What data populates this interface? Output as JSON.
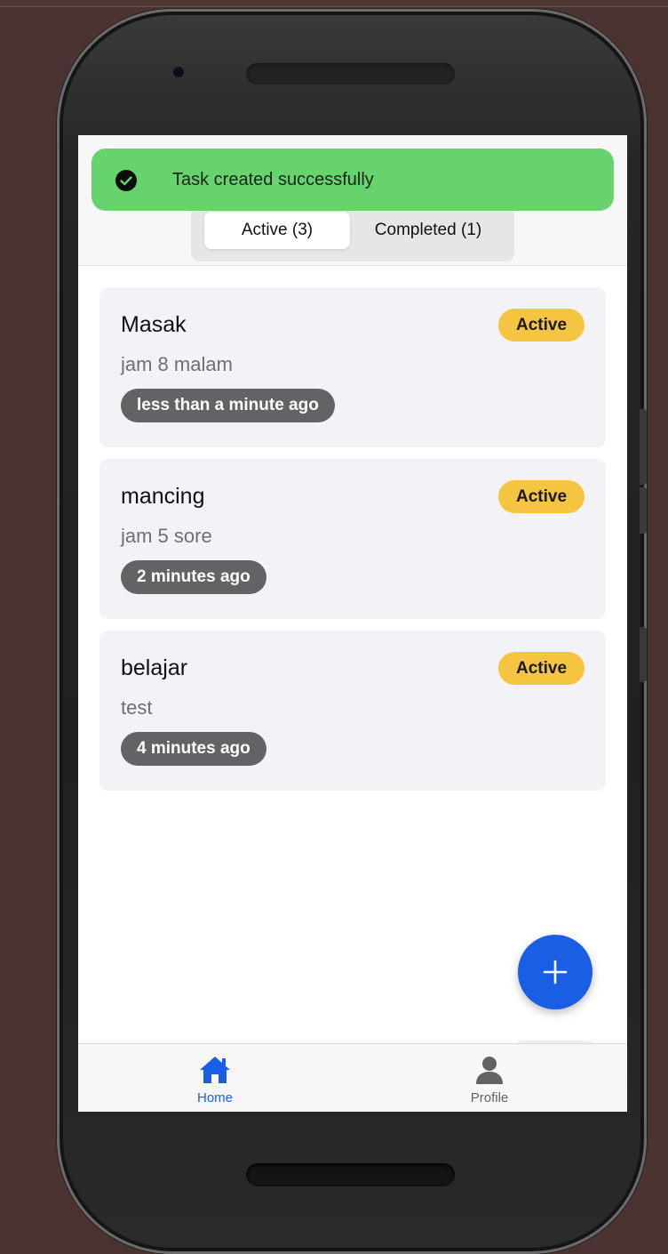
{
  "toast": {
    "message": "Task created successfully"
  },
  "tabs": {
    "active_label": "Active (3)",
    "completed_label": "Completed (1)"
  },
  "tasks": [
    {
      "title": "Masak",
      "description": "jam 8 malam",
      "time": "less than a minute ago",
      "status": "Active"
    },
    {
      "title": "mancing",
      "description": "jam 5 sore",
      "time": "2 minutes ago",
      "status": "Active"
    },
    {
      "title": "belajar",
      "description": "test",
      "time": "4 minutes ago",
      "status": "Active"
    }
  ],
  "bottom_nav": {
    "home_label": "Home",
    "profile_label": "Profile"
  },
  "colors": {
    "accent": "#1a5ee6",
    "toast_bg": "#67d36c",
    "badge_active": "#f5c542",
    "time_pill": "#636366"
  },
  "icons": {
    "toast": "check-circle-icon",
    "fab": "plus-icon",
    "home": "home-icon",
    "profile": "person-icon"
  }
}
